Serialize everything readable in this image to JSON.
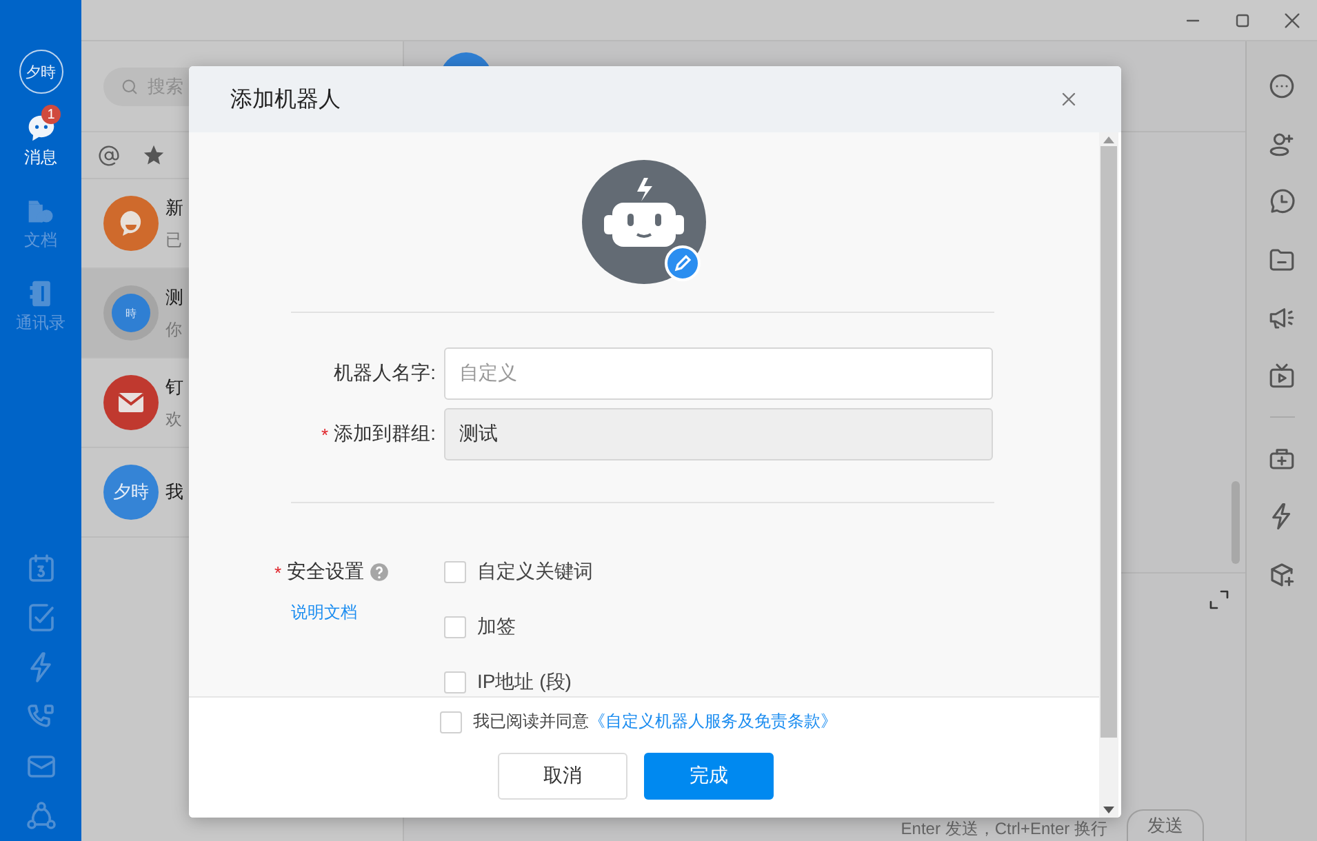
{
  "nav": {
    "avatar": "夕時",
    "items": [
      {
        "label": "消息",
        "selected": true,
        "badge": "1"
      },
      {
        "label": "文档",
        "selected": false
      },
      {
        "label": "通讯录",
        "selected": false
      }
    ]
  },
  "conversation_list": {
    "search": {
      "placeholder": "搜索"
    },
    "items": [
      {
        "kind": "hi",
        "title": "新",
        "subtitle": "已",
        "selected": false
      },
      {
        "kind": "group",
        "avatar_text": "時",
        "title": "测",
        "subtitle": "你",
        "selected": true
      },
      {
        "kind": "mail",
        "title": "钉",
        "subtitle": "欢",
        "selected": false
      },
      {
        "kind": "initials",
        "avatar_text": "夕時",
        "title": "我",
        "selected": false
      }
    ]
  },
  "chat": {
    "input_hint": "Enter 发送，Ctrl+Enter 换行",
    "send_button": "发送"
  },
  "dialog": {
    "title": "添加机器人",
    "fields": [
      {
        "label": "机器人名字:",
        "placeholder": "自定义",
        "disabled": false
      },
      {
        "label": "添加到群组:",
        "required_mark": "*",
        "value": "测试",
        "disabled": true
      }
    ],
    "security": {
      "label": "安全设置",
      "required_mark": "*",
      "help_link": "说明文档",
      "options": [
        {
          "label": "自定义关键词",
          "checked": false
        },
        {
          "label": "加签",
          "checked": false
        },
        {
          "label": "IP地址 (段)",
          "checked": false
        }
      ]
    },
    "agreement": {
      "text": "我已阅读并同意",
      "link": "《自定义机器人服务及免责条款》",
      "checked": false
    },
    "buttons": [
      {
        "label": "取消",
        "kind": "secondary"
      },
      {
        "label": "完成",
        "kind": "primary"
      }
    ]
  }
}
